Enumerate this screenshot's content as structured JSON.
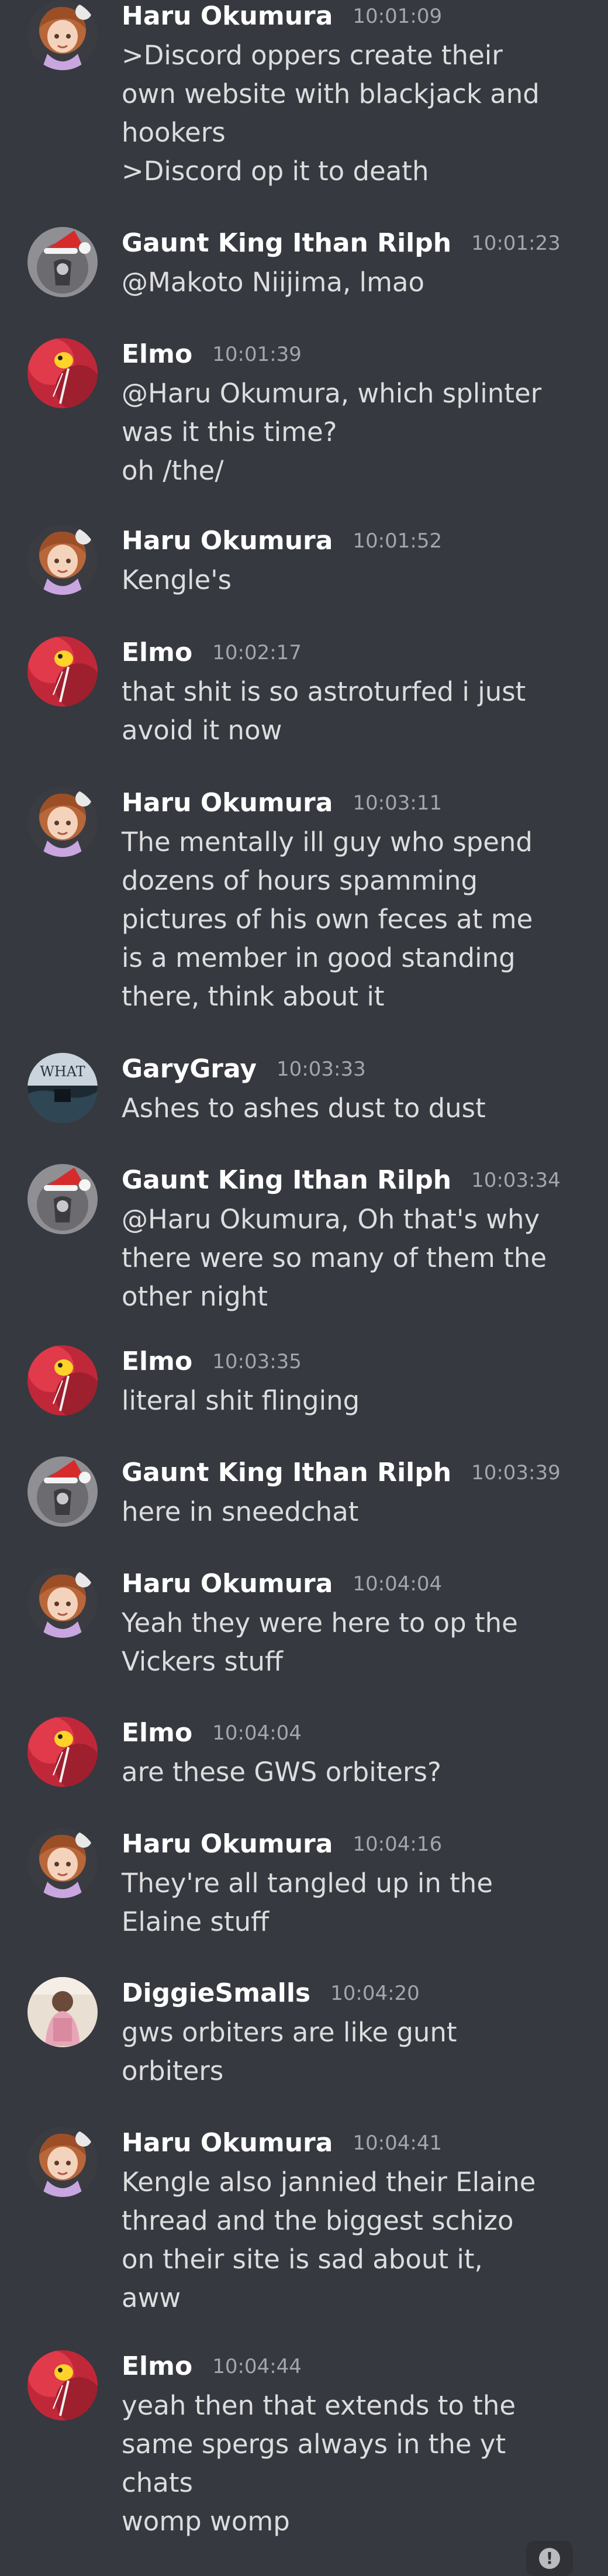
{
  "messages": [
    {
      "author": "Haru Okumura",
      "time": "10:01:09",
      "avatar": "haru-avatar",
      "lines": [
        ">Discord oppers create their",
        "own website with blackjack and",
        "hookers",
        ">Discord op it to death"
      ]
    },
    {
      "author": "Gaunt King Ithan Rilph",
      "time": "10:01:23",
      "avatar": "ithan-avatar",
      "lines": [
        "@Makoto Niijima, lmao"
      ]
    },
    {
      "author": "Elmo",
      "time": "10:01:39",
      "avatar": "elmo-avatar",
      "lines": [
        "@Haru Okumura, which splinter",
        "was it this time?",
        "oh /the/"
      ]
    },
    {
      "author": "Haru Okumura",
      "time": "10:01:52",
      "avatar": "haru-avatar",
      "lines": [
        "Kengle's"
      ]
    },
    {
      "author": "Elmo",
      "time": "10:02:17",
      "avatar": "elmo-avatar",
      "lines": [
        "that shit is so astroturfed i just",
        "avoid it now"
      ]
    },
    {
      "author": "Haru Okumura",
      "time": "10:03:11",
      "avatar": "haru-avatar",
      "lines": [
        "The mentally ill guy who spend",
        "dozens of hours spamming",
        "pictures of his own feces at me",
        "is a member in good standing",
        "there, think about it"
      ]
    },
    {
      "author": "GaryGray",
      "time": "10:03:33",
      "avatar": "gary-avatar",
      "avatar_text": "WHAT",
      "lines": [
        "Ashes to ashes dust to dust"
      ]
    },
    {
      "author": "Gaunt King Ithan Rilph",
      "time": "10:03:34",
      "avatar": "ithan-avatar",
      "lines": [
        "@Haru Okumura, Oh that's why",
        "there were so many of them the",
        "other night"
      ]
    },
    {
      "author": "Elmo",
      "time": "10:03:35",
      "avatar": "elmo-avatar",
      "lines": [
        "literal shit flinging"
      ]
    },
    {
      "author": "Gaunt King Ithan Rilph",
      "time": "10:03:39",
      "avatar": "ithan-avatar",
      "lines": [
        "here in sneedchat"
      ]
    },
    {
      "author": "Haru Okumura",
      "time": "10:04:04",
      "avatar": "haru-avatar",
      "lines": [
        "Yeah they were here to op the",
        "Vickers stuff"
      ]
    },
    {
      "author": "Elmo",
      "time": "10:04:04",
      "avatar": "elmo-avatar",
      "lines": [
        "are these GWS orbiters?"
      ]
    },
    {
      "author": "Haru Okumura",
      "time": "10:04:16",
      "avatar": "haru-avatar",
      "lines": [
        "They're all tangled up in the",
        "Elaine stuff"
      ]
    },
    {
      "author": "DiggieSmalls",
      "time": "10:04:20",
      "avatar": "diggie-avatar",
      "lines": [
        "gws orbiters are like gunt",
        "orbiters"
      ]
    },
    {
      "author": "Haru Okumura",
      "time": "10:04:41",
      "avatar": "haru-avatar",
      "lines": [
        "Kengle also jannied their Elaine",
        "thread and the biggest schizo",
        "on their site is sad about it,",
        "aww"
      ]
    },
    {
      "author": "Elmo",
      "time": "10:04:44",
      "avatar": "elmo-avatar",
      "lines": [
        "yeah then that extends to the",
        "same spergs always in the yt",
        "chats",
        "womp womp"
      ]
    }
  ],
  "scroll_badge_icon": "exclamation-icon",
  "scroll_badge_text": "!",
  "colors": {
    "background": "#36393f",
    "author": "#ffffff",
    "timestamp": "#a3a6aa",
    "message": "#dcddde"
  }
}
